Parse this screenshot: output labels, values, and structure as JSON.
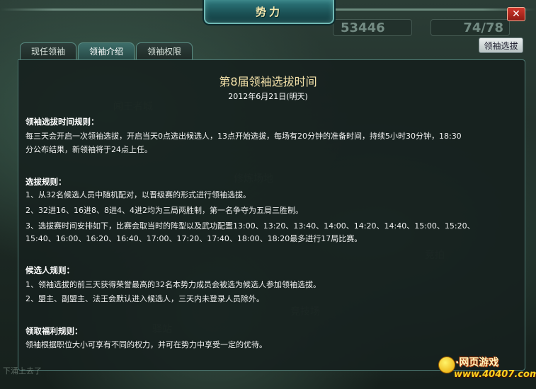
{
  "window": {
    "title": "势力",
    "close_label": "✕"
  },
  "scores": {
    "left": "53446",
    "right": "74/78"
  },
  "tabs": [
    {
      "label": "现任领袖",
      "active": false
    },
    {
      "label": "领袖介绍",
      "active": true
    },
    {
      "label": "领袖权限",
      "active": false
    }
  ],
  "leader_select_button": "领袖选拔",
  "content": {
    "title": "第8届领袖选拔时间",
    "date": "2012年6月21日(明天)",
    "sections": [
      {
        "heading": "领袖选拔时间规则：",
        "lines": [
          "每三天会开启一次领袖选拔，开启当天0点选出候选人，13点开始选拔，每场有20分钟的准备时间，持续5小时30分钟，18:30",
          "分公布结果，新领袖将于24点上任。"
        ]
      },
      {
        "heading": "选拔规则：",
        "lines": [
          "1、从32名候选人员中随机配对，以晋级赛的形式进行领袖选拔。",
          "2、32进16、16进8、8进4、4进2均为三局两胜制，第一名争夺为五局三胜制。",
          "3、选拔赛时间安排如下，比赛会取当时的阵型以及武功配置13:00、13:20、13:40、14:00、14:20、14:40、15:00、15:20、",
          "15:40、16:00、16:20、16:40、17:00、17:20、17:40、18:00、18:20最多进行17局比赛。"
        ]
      },
      {
        "heading": "候选人规则：",
        "lines": [
          "1、领袖选拔的前三天获得荣誉最高的32名本势力成员会被选为候选人参加领袖选拔。",
          "2、盟主、副盟主、法王会默认进入候选人，三天内未登录人员除外。"
        ]
      },
      {
        "heading": "领取福利规则：",
        "lines": [
          "领袖根据职位大小可享有不同的权力，并可在势力中享受一定的优待。"
        ]
      }
    ]
  },
  "watermark": {
    "top": "·网页游戏",
    "url": "www.40407.com"
  },
  "colors": {
    "title": "#f2e0a8",
    "panel_border": "#4f7a74",
    "tab_active": "#3e6e6a"
  }
}
